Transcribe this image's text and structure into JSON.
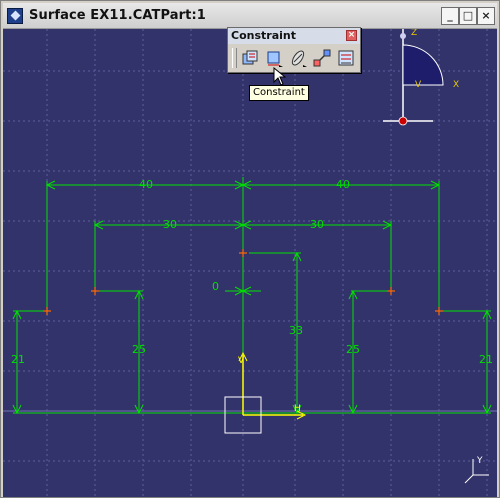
{
  "window": {
    "title": "Surface EX11.CATPart:1"
  },
  "window_buttons": {
    "minimize": "_",
    "maximize": "□",
    "close": "×"
  },
  "toolbar": {
    "title": "Constraint",
    "close": "×",
    "tools": [
      "constraints-defined-in-dialog-box",
      "constraint",
      "contact-constraint",
      "fix-together",
      "auto-constraint"
    ],
    "tooltip": "Constraint"
  },
  "compass": {
    "z_label": "Z",
    "x_label": "X",
    "y_label": "V"
  },
  "axis_indicator": {
    "y_label": "Y"
  },
  "dimensions": {
    "top_left": "40",
    "top_right": "40",
    "mid_left": "30",
    "mid_right": "30",
    "zero": "0",
    "center_height": "33",
    "left_inner": "25",
    "right_inner": "25",
    "left_outer": "21",
    "right_outer": "21",
    "h_label": "H",
    "v_label": "V"
  },
  "colors": {
    "background": "#33336b",
    "grid": "#5c5c9c",
    "geometry": "#00e000",
    "point": "#ff6a00",
    "axis": "#ffff00"
  }
}
